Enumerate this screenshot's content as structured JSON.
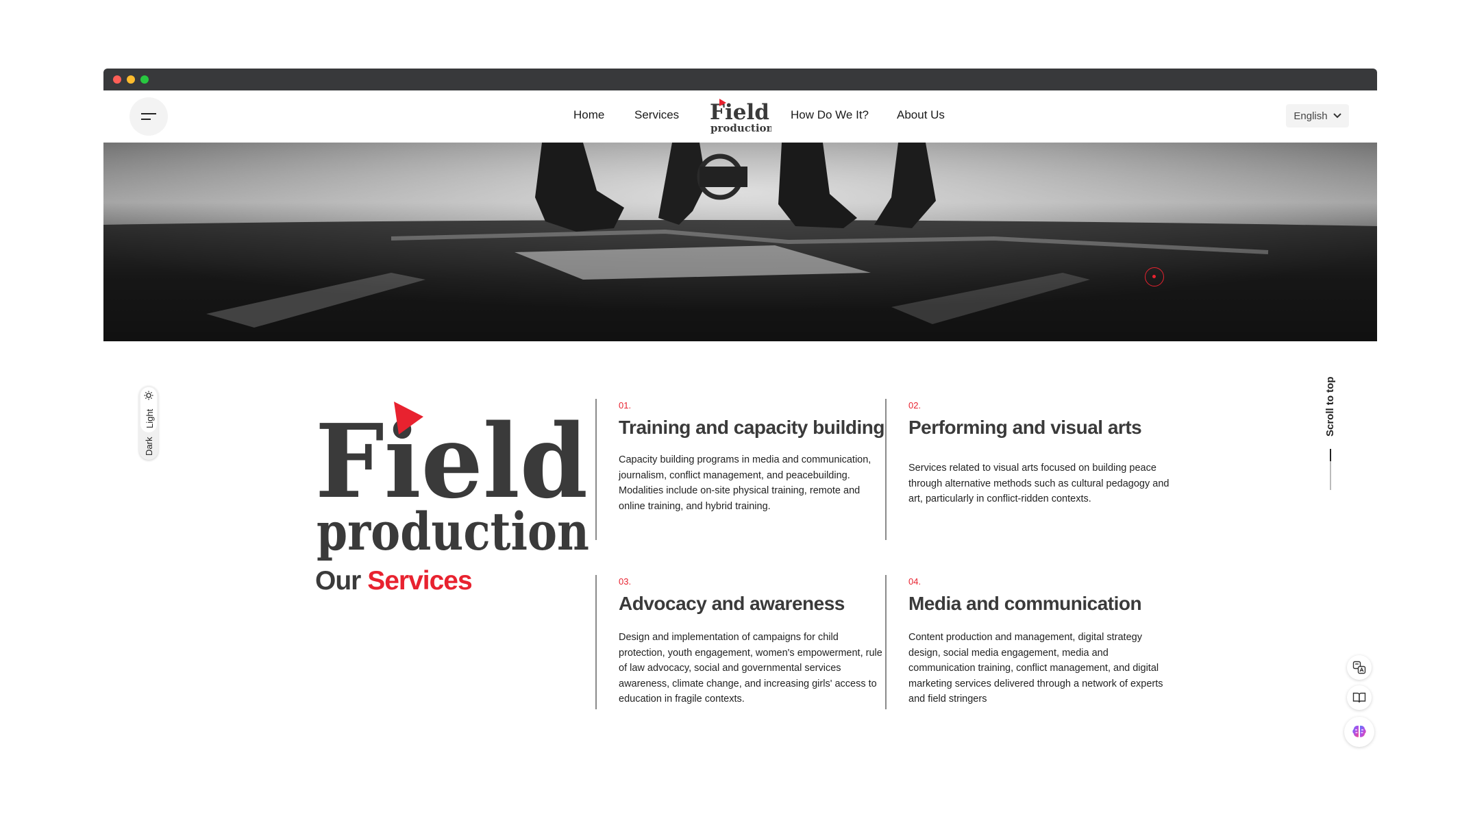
{
  "nav": {
    "links": [
      "Home",
      "Services",
      "How Do We It?",
      "About Us"
    ],
    "logo_text": [
      "Field",
      "production"
    ],
    "language": "English"
  },
  "theme_toggle": {
    "light_label": "Light",
    "dark_label": "Dark"
  },
  "brand": {
    "logo_text": [
      "Field",
      "production"
    ],
    "heading_part1": "Our",
    "heading_part2": "Services"
  },
  "services": [
    {
      "num": "01.",
      "title": "Training and capacity building",
      "desc": "Capacity building programs in media and communication, journalism, conflict management, and peacebuilding. Modalities include on-site physical training, remote and online training, and hybrid training."
    },
    {
      "num": "02.",
      "title": "Performing and visual arts",
      "desc": "Services related to visual arts focused on building peace through alternative methods such as cultural pedagogy and art, particularly in conflict-ridden contexts."
    },
    {
      "num": "03.",
      "title": "Advocacy and awareness",
      "desc": "Design and implementation of campaigns for child protection, youth engagement, women's empowerment, rule of law advocacy, social and governmental services awareness, climate change, and increasing girls' access to education in fragile contexts."
    },
    {
      "num": "04.",
      "title": "Media and communication",
      "desc": "Content production and management, digital strategy design, social media engagement, media and communication training, conflict management, and digital marketing services delivered through a network of experts and field stringers"
    }
  ],
  "scroll_top": "Scroll to top",
  "side_tools": [
    "translate-icon",
    "reader-icon",
    "brain-icon"
  ],
  "colors": {
    "accent": "#e8222f",
    "text": "#3a3a3a",
    "chrome": "#38393b"
  }
}
